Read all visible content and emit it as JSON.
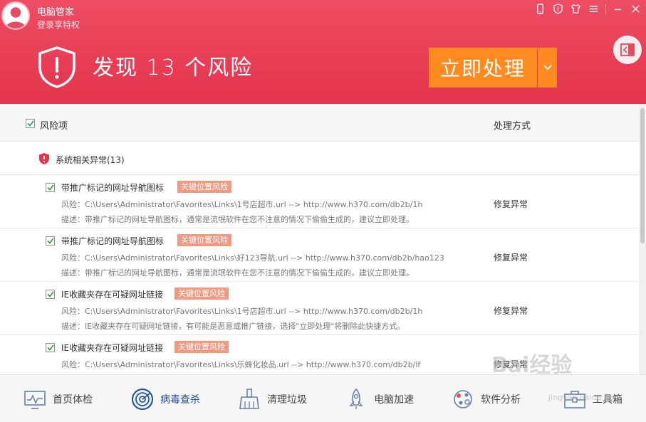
{
  "header": {
    "app_name": "电脑管家",
    "login_link": "登录享特权",
    "headline": "发现 13 个风险",
    "action_label": "立即处理"
  },
  "list": {
    "col_title": "风险项",
    "col_action": "处理方式",
    "group_label": "系统相关异常(13)",
    "items": [
      {
        "title": "带推广标记的网址导航图标",
        "tag": "关键位置风险",
        "path": "风险：C:\\Users\\Administrator\\Favorites\\Links\\1号店超市.url --> http://www.h370.com/db2b/1h",
        "desc": "描述：带推广标记的网址导航图标，通常是流氓软件在您不注意的情况下偷偷生成的，建议立即处理。",
        "fix": "修复异常"
      },
      {
        "title": "带推广标记的网址导航图标",
        "tag": "关键位置风险",
        "path": "风险：C:\\Users\\Administrator\\Favorites\\Links\\好123导航.url --> http://www.h370.com/db2b/hao123",
        "desc": "描述：带推广标记的网址导航图标，通常是流氓软件在您不注意的情况下偷偷生成的，建议立即处理。",
        "fix": "修复异常"
      },
      {
        "title": "IE收藏夹存在可疑网址链接",
        "tag": "关键位置风险",
        "path": "风险：C:\\Users\\Administrator\\Favorites\\Links\\1号店超市.url --> http://www.h370.com/db2b/1h",
        "desc": "描述：IE收藏夹存在可疑网址链接，有可能是恶意或推广链接，选择\"立即处理\"将删除此快捷方式。",
        "fix": "修复异常"
      },
      {
        "title": "IE收藏夹存在可疑网址链接",
        "tag": "关键位置风险",
        "path": "风险：C:\\Users\\Administrator\\Favorites\\Links\\乐蜂化妆品.url --> http://www.h370.com/db2b/lf",
        "desc": "",
        "fix": "修复异常"
      }
    ]
  },
  "nav": {
    "items": [
      {
        "label": "首页体检",
        "icon": "monitor-icon"
      },
      {
        "label": "病毒查杀",
        "icon": "radar-icon"
      },
      {
        "label": "清理垃圾",
        "icon": "broom-icon"
      },
      {
        "label": "电脑加速",
        "icon": "rocket-icon"
      },
      {
        "label": "软件分析",
        "icon": "software-icon"
      },
      {
        "label": "工具箱",
        "icon": "toolbox-icon"
      }
    ]
  },
  "watermark": {
    "brand": "Bai经验",
    "url": "jingyan.baidu.com"
  },
  "colors": {
    "header_red": "#e83d55",
    "action_orange": "#ff8a1f",
    "tag_salmon": "#f09983",
    "nav_active_blue": "#1d4d94"
  }
}
